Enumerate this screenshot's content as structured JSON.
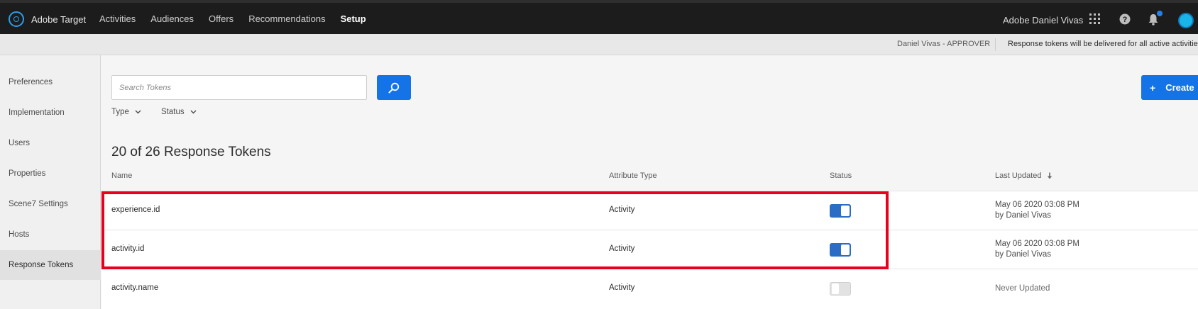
{
  "app": {
    "name": "Adobe Target"
  },
  "nav": {
    "items": [
      "Activities",
      "Audiences",
      "Offers",
      "Recommendations",
      "Setup"
    ],
    "active": "Setup"
  },
  "user": {
    "name": "Adobe Daniel Vivas"
  },
  "subbar": {
    "role": "Daniel Vivas - APPROVER",
    "note": "Response tokens will be delivered for all active activities"
  },
  "sidebar": {
    "items": [
      {
        "label": "Preferences"
      },
      {
        "label": "Implementation"
      },
      {
        "label": "Users"
      },
      {
        "label": "Properties"
      },
      {
        "label": "Scene7 Settings"
      },
      {
        "label": "Hosts"
      },
      {
        "label": "Response Tokens"
      }
    ],
    "active": "Response Tokens"
  },
  "search": {
    "placeholder": "Search Tokens"
  },
  "toolbar": {
    "create_label": "Create",
    "create_icon": "+"
  },
  "filters": {
    "type_label": "Type",
    "status_label": "Status"
  },
  "list": {
    "count_title": "20 of 26 Response Tokens"
  },
  "table": {
    "headers": {
      "name": "Name",
      "attribute_type": "Attribute Type",
      "status": "Status",
      "last_updated": "Last Updated"
    },
    "sort": {
      "column": "Last Updated",
      "direction": "descending"
    },
    "rows": [
      {
        "name": "experience.id",
        "attribute_type": "Activity",
        "enabled": true,
        "updated_date": "May 06 2020 03:08 PM",
        "updated_by": "by Daniel Vivas"
      },
      {
        "name": "activity.id",
        "attribute_type": "Activity",
        "enabled": true,
        "updated_date": "May 06 2020 03:08 PM",
        "updated_by": "by Daniel Vivas"
      },
      {
        "name": "activity.name",
        "attribute_type": "Activity",
        "enabled": false,
        "updated_date": "Never Updated",
        "updated_by": ""
      }
    ]
  },
  "colors": {
    "accent": "#1473e6",
    "topbar": "#1c1c1c",
    "highlight": "#e8001c",
    "toggle_on": "#2b6cc4"
  }
}
